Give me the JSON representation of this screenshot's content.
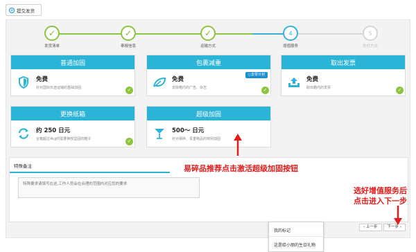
{
  "toolbar": {
    "submit_label": "提交发货",
    "plus": "+"
  },
  "stepper": {
    "steps": [
      {
        "label": "发货清单",
        "mark": "✓"
      },
      {
        "label": "奉报信息",
        "mark": "✓"
      },
      {
        "label": "运输方式",
        "mark": "✓"
      },
      {
        "label": "增值服务",
        "mark": "4"
      },
      {
        "label": "支付方式",
        "mark": "5"
      }
    ]
  },
  "services": [
    {
      "title": "普通加固",
      "price": "免费",
      "desc": "针对国际长途运输的基础加固",
      "icon": "shield-icon"
    },
    {
      "title": "包裹减重",
      "price": "免费",
      "desc": "去除箱内的广告、杂志",
      "icon": "leaf-icon",
      "badge": "去零计划"
    },
    {
      "title": "取出发票",
      "price": "免费",
      "desc": "取出箱内的发票",
      "icon": "upload-tray-icon"
    },
    {
      "title": "更换纸箱",
      "price": "约 250 日元",
      "desc": "合箱超过4kg时需要换较坚固的箱子",
      "icon": "refresh-icon"
    },
    {
      "title": "超级加固",
      "price": "500～ 日元",
      "desc": "针对易碎、贵重物品的特别加固",
      "icon": "cocktail-glass-icon"
    }
  ],
  "remarks": {
    "title": "特殊备注",
    "placeholder": "特殊要求请填写在这,工作人员会在合理的范围内对应您的要求"
  },
  "pager": {
    "prev": "‹ 上一步",
    "next": "下一步 ›"
  },
  "annotations": {
    "fragile_tip": "易碎品推荐点击激活超级加固按钮",
    "next_tip_line1": "选好增值服务后",
    "next_tip_line2": "点击进入下一步"
  },
  "popup": {
    "title": "我的标记",
    "item": "这是给小丽的生日礼物"
  },
  "colors": {
    "accent": "#2cb4d8",
    "done": "#8dc43f",
    "annotation": "#e41b1b"
  }
}
